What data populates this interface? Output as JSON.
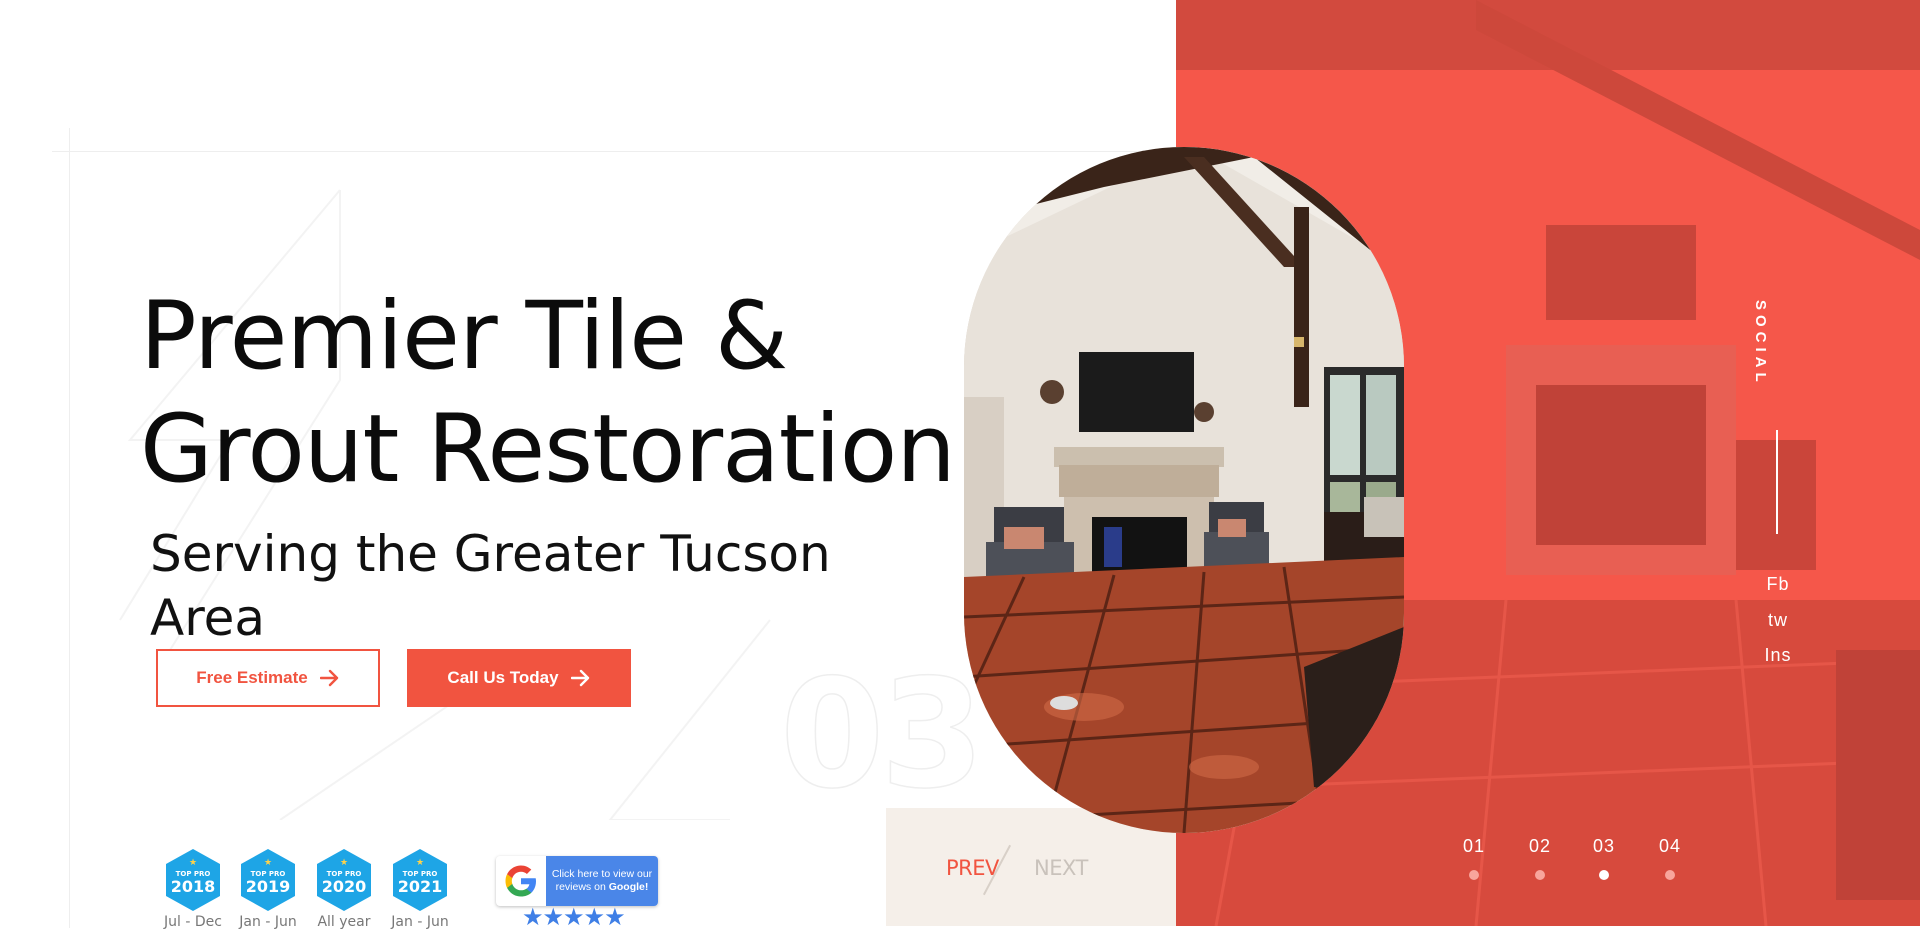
{
  "hero": {
    "title_line1": "Premier Tile &",
    "title_line2": "Grout Restoration",
    "subtitle": "Serving the Greater Tucson Area",
    "slide_number": "03"
  },
  "buttons": {
    "free_estimate": "Free Estimate",
    "call_us": "Call Us Today"
  },
  "nav": {
    "prev": "PREV",
    "next": "NEXT"
  },
  "social": {
    "label": "SOCIAL",
    "links": [
      "Fb",
      "tw",
      "Ins"
    ]
  },
  "pager": {
    "items": [
      "01",
      "02",
      "03",
      "04"
    ],
    "active_index": 2
  },
  "badges": [
    {
      "top": "TOP PRO",
      "year": "2018",
      "caption": "Jul - Dec"
    },
    {
      "top": "TOP PRO",
      "year": "2019",
      "caption": "Jan - Jun"
    },
    {
      "top": "TOP PRO",
      "year": "2020",
      "caption": "All year"
    },
    {
      "top": "TOP PRO",
      "year": "2021",
      "caption": "Jan - Jun"
    }
  ],
  "google": {
    "line1": "Click here to view our",
    "line2": "reviews on",
    "brand": "Google!",
    "stars": "★★★★★"
  },
  "colors": {
    "accent": "#f15440",
    "panel": "#f5574a",
    "badge": "#1ea5e6",
    "google_blue": "#4a86e8"
  }
}
